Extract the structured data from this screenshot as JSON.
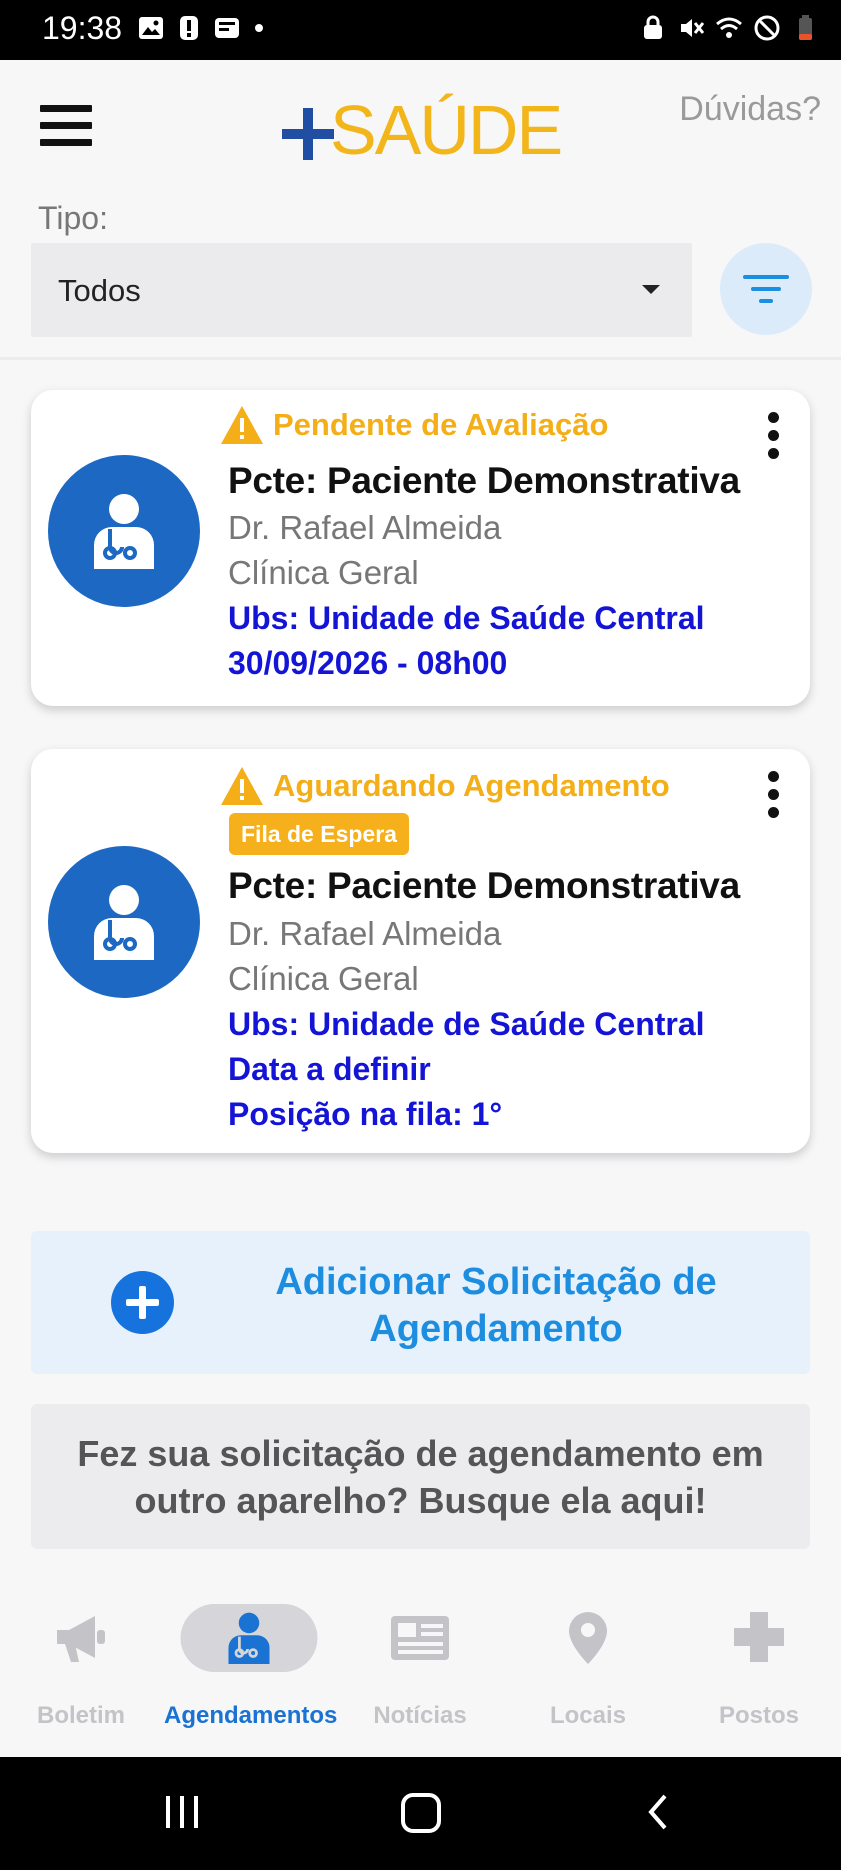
{
  "status_bar": {
    "time": "19:38"
  },
  "header": {
    "logo_text": "SAÚDE",
    "help_link": "Dúvidas?",
    "type_label": "Tipo:",
    "type_value": "Todos"
  },
  "cards": [
    {
      "status": "Pendente de Avaliação",
      "badge": "",
      "patient": "Pcte: Paciente Demonstrativa",
      "doctor": "Dr. Rafael Almeida",
      "specialty": "Clínica Geral",
      "unit": "Ubs: Unidade de Saúde Central",
      "date": "30/09/2026 - 08h00"
    },
    {
      "status": "Aguardando Agendamento",
      "badge": "Fila de Espera",
      "patient": "Pcte: Paciente Demonstrativa",
      "doctor": "Dr. Rafael Almeida",
      "specialty": "Clínica Geral",
      "unit": "Ubs: Unidade de Saúde Central",
      "date": "Data a definir",
      "queue_position": "Posição na fila: 1°"
    }
  ],
  "actions": {
    "add_request_line1": "Adicionar Solicitação de",
    "add_request_line2": "Agendamento",
    "search_other_line1": "Fez sua solicitação de agendamento em",
    "search_other_line2": "outro aparelho? Busque ela aqui!"
  },
  "bottom_nav": {
    "items": [
      {
        "label": "Boletim",
        "icon": "megaphone-icon",
        "active": false
      },
      {
        "label": "Agendamentos",
        "icon": "doctor-icon",
        "active": true
      },
      {
        "label": "Notícias",
        "icon": "newspaper-icon",
        "active": false
      },
      {
        "label": "Locais",
        "icon": "location-pin-icon",
        "active": false
      },
      {
        "label": "Postos",
        "icon": "medical-cross-icon",
        "active": false
      }
    ]
  },
  "colors": {
    "accent_blue": "#1c68c2",
    "status_orange": "#f3ae18",
    "link_blue": "#1414d6",
    "logo_yellow": "#f2b61b",
    "logo_blue": "#1f4ea3"
  }
}
